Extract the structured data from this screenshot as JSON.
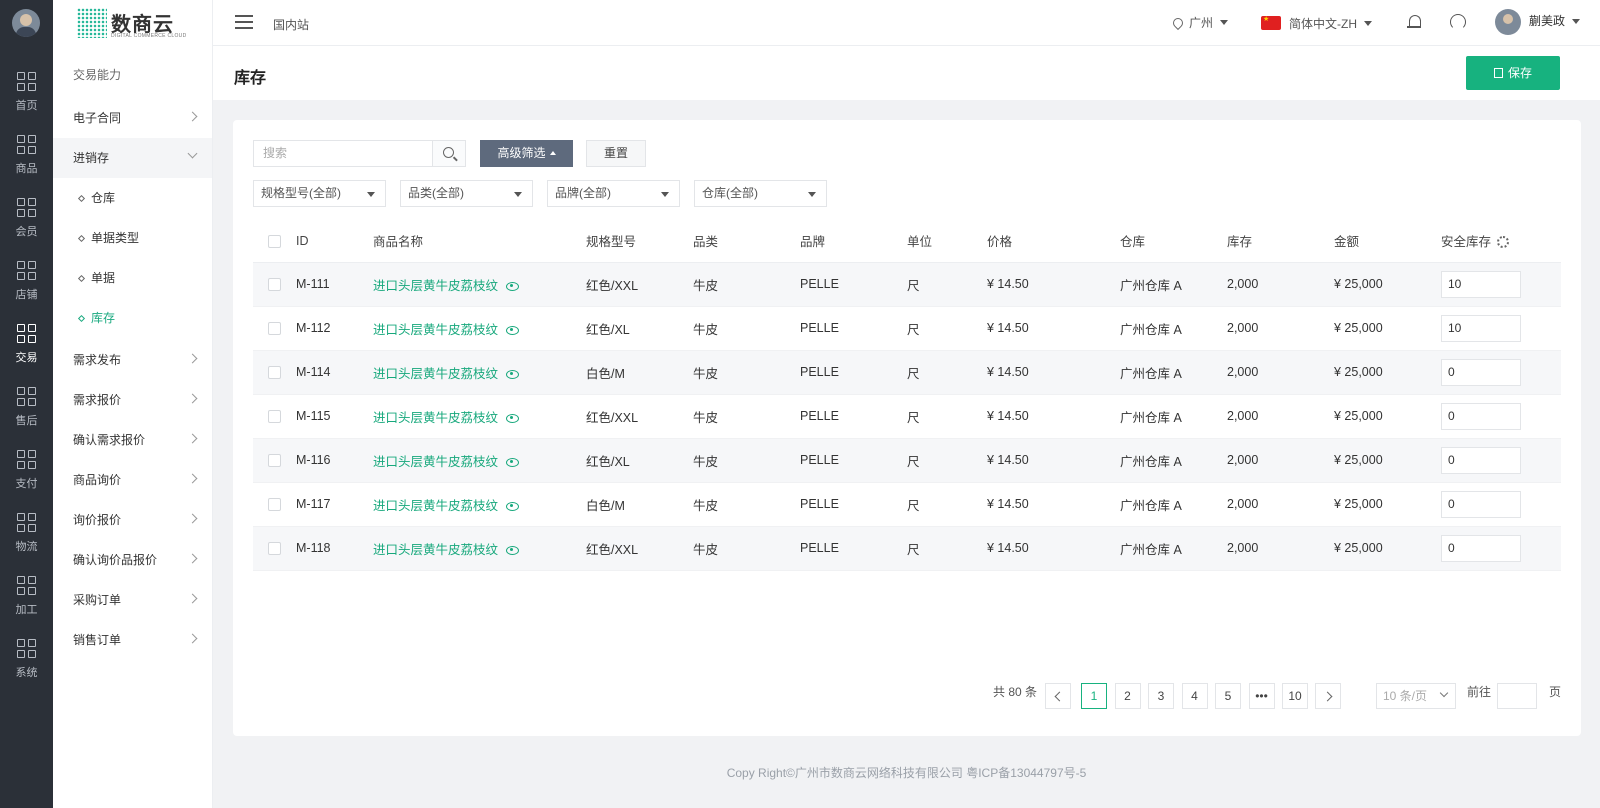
{
  "rail": {
    "items": [
      {
        "label": "首页"
      },
      {
        "label": "商品"
      },
      {
        "label": "会员"
      },
      {
        "label": "店铺"
      },
      {
        "label": "交易"
      },
      {
        "label": "售后"
      },
      {
        "label": "支付"
      },
      {
        "label": "物流"
      },
      {
        "label": "加工"
      },
      {
        "label": "系统"
      }
    ],
    "active_index": 4
  },
  "logo": {
    "brand": "数商云",
    "sub": "DIGITAL COMMERCE CLOUD"
  },
  "sidebar": {
    "header": "交易能力",
    "items": [
      {
        "label": "电子合同"
      },
      {
        "label": "进销存"
      },
      {
        "label": "需求发布"
      },
      {
        "label": "需求报价"
      },
      {
        "label": "确认需求报价"
      },
      {
        "label": "商品询价"
      },
      {
        "label": "询价报价"
      },
      {
        "label": "确认询价品报价"
      },
      {
        "label": "采购订单"
      },
      {
        "label": "销售订单"
      }
    ],
    "subitems": [
      {
        "label": "仓库"
      },
      {
        "label": "单据类型"
      },
      {
        "label": "单据"
      },
      {
        "label": "库存"
      }
    ]
  },
  "topbar": {
    "site": "国内站",
    "location": "广州",
    "language": "简体中文-ZH",
    "user": "蒯美政"
  },
  "page": {
    "title": "库存",
    "save_label": "保存"
  },
  "toolbar": {
    "search_placeholder": "搜索",
    "advanced_label": "高级筛选",
    "reset_label": "重置",
    "filters": [
      {
        "label": "规格型号(全部)"
      },
      {
        "label": "品类(全部)"
      },
      {
        "label": "品牌(全部)"
      },
      {
        "label": "仓库(全部)"
      }
    ]
  },
  "table": {
    "headers": [
      "ID",
      "商品名称",
      "规格型号",
      "品类",
      "品牌",
      "单位",
      "价格",
      "仓库",
      "库存",
      "金额",
      "安全库存"
    ],
    "rows": [
      {
        "id": "M-111",
        "name": "进口头层黄牛皮荔枝纹",
        "spec": "红色/XXL",
        "category": "牛皮",
        "brand": "PELLE",
        "unit": "尺",
        "price": "¥ 14.50",
        "warehouse": "广州仓库 A",
        "stock": "2,000",
        "amount": "¥ 25,000",
        "safety": "10"
      },
      {
        "id": "M-112",
        "name": "进口头层黄牛皮荔枝纹",
        "spec": "红色/XL",
        "category": "牛皮",
        "brand": "PELLE",
        "unit": "尺",
        "price": "¥ 14.50",
        "warehouse": "广州仓库 A",
        "stock": "2,000",
        "amount": "¥ 25,000",
        "safety": "10"
      },
      {
        "id": "M-114",
        "name": "进口头层黄牛皮荔枝纹",
        "spec": "白色/M",
        "category": "牛皮",
        "brand": "PELLE",
        "unit": "尺",
        "price": "¥ 14.50",
        "warehouse": "广州仓库 A",
        "stock": "2,000",
        "amount": "¥ 25,000",
        "safety": "0"
      },
      {
        "id": "M-115",
        "name": "进口头层黄牛皮荔枝纹",
        "spec": "红色/XXL",
        "category": "牛皮",
        "brand": "PELLE",
        "unit": "尺",
        "price": "¥ 14.50",
        "warehouse": "广州仓库 A",
        "stock": "2,000",
        "amount": "¥ 25,000",
        "safety": "0"
      },
      {
        "id": "M-116",
        "name": "进口头层黄牛皮荔枝纹",
        "spec": "红色/XL",
        "category": "牛皮",
        "brand": "PELLE",
        "unit": "尺",
        "price": "¥ 14.50",
        "warehouse": "广州仓库 A",
        "stock": "2,000",
        "amount": "¥ 25,000",
        "safety": "0"
      },
      {
        "id": "M-117",
        "name": "进口头层黄牛皮荔枝纹",
        "spec": "白色/M",
        "category": "牛皮",
        "brand": "PELLE",
        "unit": "尺",
        "price": "¥ 14.50",
        "warehouse": "广州仓库 A",
        "stock": "2,000",
        "amount": "¥ 25,000",
        "safety": "0"
      },
      {
        "id": "M-118",
        "name": "进口头层黄牛皮荔枝纹",
        "spec": "红色/XXL",
        "category": "牛皮",
        "brand": "PELLE",
        "unit": "尺",
        "price": "¥ 14.50",
        "warehouse": "广州仓库 A",
        "stock": "2,000",
        "amount": "¥ 25,000",
        "safety": "0"
      }
    ]
  },
  "pagination": {
    "total": "共 80 条",
    "pages": [
      "1",
      "2",
      "3",
      "4",
      "5",
      "•••",
      "10"
    ],
    "current": "1",
    "per_page": "10 条/页",
    "goto_label": "前往",
    "page_suffix": "页"
  },
  "footer": "Copy Right©广州市数商云网络科技有限公司 粤ICP备13044797号-5",
  "colors": {
    "accent": "#17b27f",
    "rail": "#2b3038",
    "filter_button": "#5e6a7d"
  }
}
